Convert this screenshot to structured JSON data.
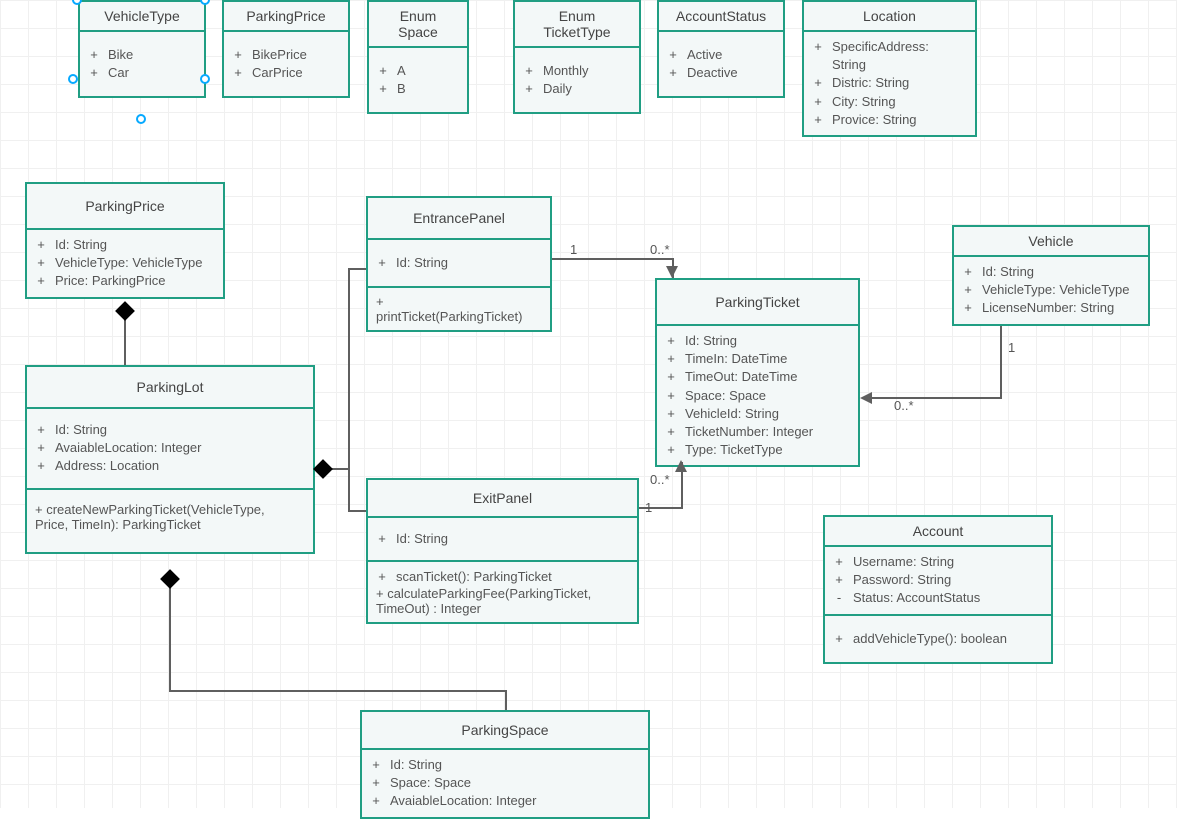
{
  "enums": {
    "vehicleType": {
      "title": "VehicleType",
      "members": [
        {
          "v": "+",
          "t": "Bike"
        },
        {
          "v": "+",
          "t": "Car"
        }
      ]
    },
    "parkingPriceEnum": {
      "title": "ParkingPrice",
      "members": [
        {
          "v": "+",
          "t": "BikePrice"
        },
        {
          "v": "+",
          "t": "CarPrice"
        }
      ]
    },
    "space": {
      "title": "Enum\nSpace",
      "members": [
        {
          "v": "+",
          "t": "A"
        },
        {
          "v": "+",
          "t": "B"
        }
      ]
    },
    "ticketType": {
      "title": "Enum\nTicketType",
      "members": [
        {
          "v": "+",
          "t": "Monthly"
        },
        {
          "v": "+",
          "t": "Daily"
        }
      ]
    },
    "accountStatus": {
      "title": "AccountStatus",
      "members": [
        {
          "v": "+",
          "t": "Active"
        },
        {
          "v": "+",
          "t": "Deactive"
        }
      ]
    },
    "location": {
      "title": "Location",
      "members": [
        {
          "v": "+",
          "t": "SpecificAddress:"
        },
        {
          "v": "",
          "t": "String"
        },
        {
          "v": "+",
          "t": "Distric: String"
        },
        {
          "v": "+",
          "t": "City: String"
        },
        {
          "v": "+",
          "t": "Provice: String"
        }
      ]
    }
  },
  "classes": {
    "parkingPrice": {
      "title": "ParkingPrice",
      "attrs": [
        {
          "v": "+",
          "t": "Id: String"
        },
        {
          "v": "+",
          "t": "VehicleType: VehicleType"
        },
        {
          "v": "+",
          "t": "Price: ParkingPrice"
        }
      ]
    },
    "entrancePanel": {
      "title": "EntrancePanel",
      "attrs": [
        {
          "v": "+",
          "t": "Id: String"
        }
      ],
      "opsRaw": "+\nprintTicket(ParkingTicket)"
    },
    "parkingTicket": {
      "title": "ParkingTicket",
      "attrs": [
        {
          "v": "+",
          "t": "Id: String"
        },
        {
          "v": "+",
          "t": "TimeIn: DateTime"
        },
        {
          "v": "+",
          "t": "TimeOut: DateTime"
        },
        {
          "v": "+",
          "t": "Space: Space"
        },
        {
          "v": "+",
          "t": "VehicleId: String"
        },
        {
          "v": "+",
          "t": "TicketNumber: Integer"
        },
        {
          "v": "+",
          "t": "Type: TicketType"
        }
      ]
    },
    "vehicle": {
      "title": "Vehicle",
      "attrs": [
        {
          "v": "+",
          "t": "Id: String"
        },
        {
          "v": "+",
          "t": "VehicleType: VehicleType"
        },
        {
          "v": "+",
          "t": "LicenseNumber: String"
        }
      ]
    },
    "parkingLot": {
      "title": "ParkingLot",
      "attrs": [
        {
          "v": "+",
          "t": "Id: String"
        },
        {
          "v": "+",
          "t": "AvaiableLocation: Integer"
        },
        {
          "v": "+",
          "t": "Address: Location"
        }
      ],
      "opsRaw": "+   createNewParkingTicket(VehicleType,\nPrice, TimeIn): ParkingTicket"
    },
    "exitPanel": {
      "title": "ExitPanel",
      "attrs": [
        {
          "v": "+",
          "t": "Id: String"
        }
      ],
      "ops": [
        {
          "v": "+",
          "t": "scanTicket(): ParkingTicket"
        }
      ],
      "opsRaw": "+    calculateParkingFee(ParkingTicket,\nTimeOut) : Integer"
    },
    "account": {
      "title": "Account",
      "attrs": [
        {
          "v": "+",
          "t": "Username: String"
        },
        {
          "v": "+",
          "t": "Password: String"
        },
        {
          "v": "-",
          "t": "Status: AccountStatus"
        }
      ],
      "ops": [
        {
          "v": "+",
          "t": "addVehicleType(): boolean"
        }
      ]
    },
    "parkingSpace": {
      "title": "ParkingSpace",
      "attrs": [
        {
          "v": "+",
          "t": "Id: String"
        },
        {
          "v": "+",
          "t": "Space: Space"
        },
        {
          "v": "+",
          "t": "AvaiableLocation: Integer"
        }
      ]
    }
  },
  "mults": {
    "ep_pt_left": "1",
    "ep_pt_right": "0..*",
    "xp_pt_bottom": "1",
    "xp_pt_top": "0..*",
    "v_pt_top": "1",
    "v_pt_bottom": "0..*"
  }
}
